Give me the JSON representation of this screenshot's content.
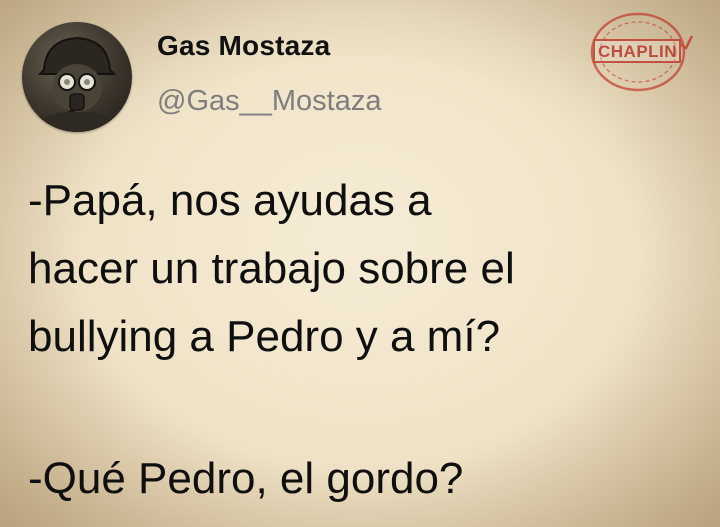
{
  "user": {
    "display_name": "Gas Mostaza",
    "handle": "@Gas__Mostaza",
    "avatar_icon": "gas-mask-soldier-icon"
  },
  "tweet": {
    "lines": [
      "-Papá, nos ayudas a",
      "hacer un trabajo sobre el",
      "bullying a Pedro y a mí?"
    ],
    "reply": "-Qué Pedro, el gordo?"
  },
  "watermark": {
    "text": "CHAPLIN",
    "icon": "stamp-icon",
    "color": "#c0392b"
  },
  "colors": {
    "background": "#f1e6cc",
    "handle": "#7e7e7e",
    "text": "#0f0f0f"
  }
}
